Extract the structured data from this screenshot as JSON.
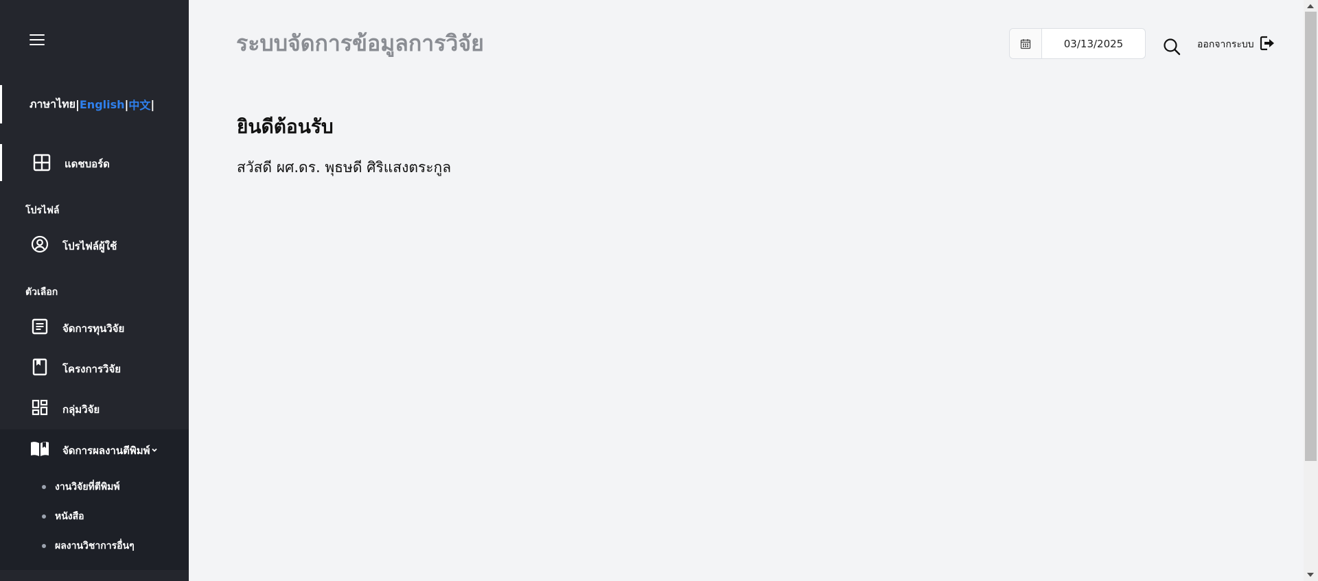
{
  "sidebar": {
    "languages": {
      "thai": "ภาษาไทย",
      "english": "English",
      "chinese": "中文",
      "separator": "|"
    },
    "dashboard": {
      "label": "แดชบอร์ด",
      "icon": "dashboard-grid-icon"
    },
    "profile_section": "โปรไฟล์",
    "profile_item": {
      "label": "โปรไฟล์ผู้ใช้",
      "icon": "user-circle-icon"
    },
    "options_section": "ตัวเลือก",
    "options": [
      {
        "label": "จัดการทุนวิจัย",
        "icon": "document-icon"
      },
      {
        "label": "โครงการวิจัย",
        "icon": "bookmark-icon"
      },
      {
        "label": "กลุ่มวิจัย",
        "icon": "widgets-icon"
      },
      {
        "label": "จัดการผลงานตีพิมพ์",
        "icon": "open-book-icon"
      }
    ],
    "publications_submenu": [
      "งานวิจัยที่ตีพิมพ์",
      "หนังสือ",
      "ผลงานวิชาการอื่นๆ"
    ]
  },
  "header": {
    "title": "ระบบจัดการข้อมูลการวิจัย",
    "date": "03/13/2025",
    "logout_label": "ออกจากระบบ"
  },
  "main": {
    "welcome": "ยินดีต้อนรับ",
    "greeting": "สวัสดี ผศ.ดร. พุธษดี ศิริแสงตระกูล"
  },
  "colors": {
    "sidebar_bg": "#24262d",
    "submenu_bg": "#1d2027",
    "main_bg": "#f3f4f6",
    "link_blue": "#2f80ed"
  }
}
